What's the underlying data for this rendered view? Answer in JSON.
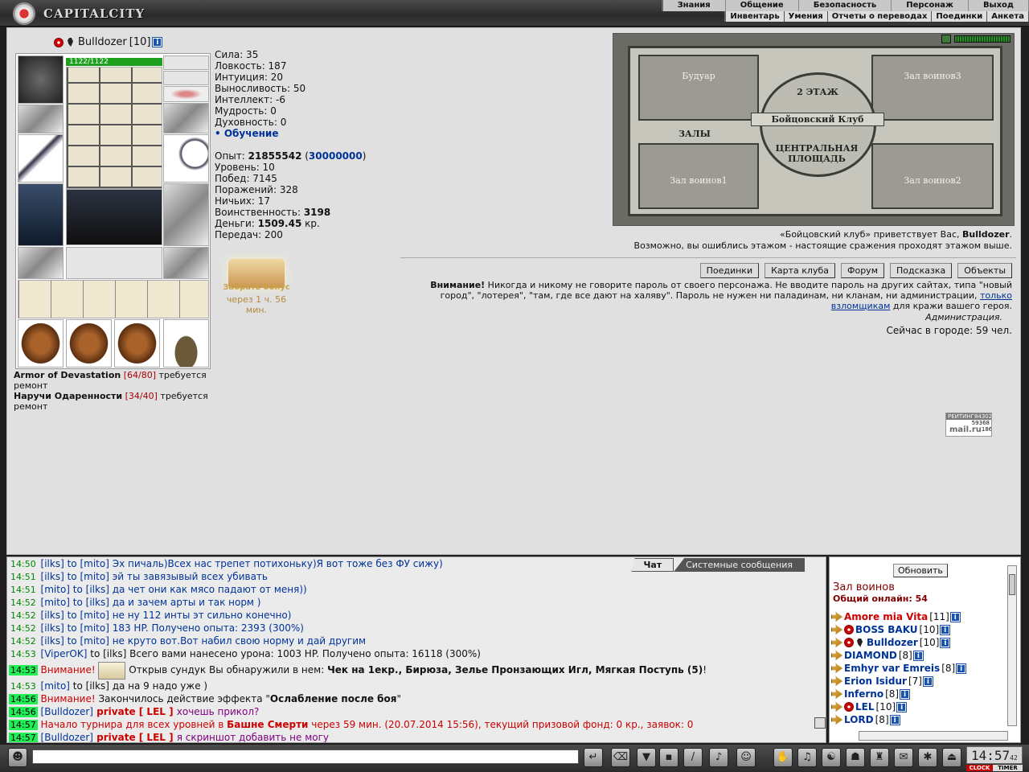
{
  "header": {
    "logo": "CAPITALCITY",
    "menu_top": [
      "Знания",
      "Общение",
      "Безопасность",
      "Персонаж",
      "Выход"
    ],
    "menu_sub": [
      "Инвентарь",
      "Умения",
      "Отчеты о переводах",
      "Поединки",
      "Анкета"
    ]
  },
  "character": {
    "name": "Bulldozer",
    "level": "[10]",
    "hp": "1122/1122"
  },
  "stats": {
    "lines": [
      "Сила: 35",
      "Ловкость: 187",
      "Интуиция: 20",
      "Выносливость: 50",
      "Интеллект: -6",
      "Мудрость: 0",
      "Духовность: 0"
    ],
    "training": "• Обучение",
    "exp_label": "Опыт: ",
    "exp": "21855542",
    "exp_next": "30000000",
    "level": "Уровень: 10",
    "wins": "Побед: 7145",
    "losses": "Поражений: 328",
    "draws": "Ничьих: 17",
    "valor_label": "Воинственность: ",
    "valor": "3198",
    "money_label": "Деньги: ",
    "money": "1509.45",
    "money_unit": " кр.",
    "transfers": "Передач: 200"
  },
  "bonus": {
    "label": "Забрать бонус",
    "time": "через 1 ч. 56 мин."
  },
  "repairs": [
    {
      "name": "Armor of Devastation",
      "dur": "[64/80]",
      "need": " требуется ремонт"
    },
    {
      "name": "Наручи Одаренности",
      "dur": "[34/40]",
      "need": " требуется ремонт"
    }
  ],
  "map": {
    "rooms": [
      "Будуар",
      "Зал воинов3",
      "Зал воинов1",
      "Зал воинов2"
    ],
    "floor": "2 ЭТАЖ",
    "club": "Бойцовский Клуб",
    "halls": "ЗАЛЫ",
    "square": "ЦЕНТРАЛЬНАЯ ПЛОЩАДЬ"
  },
  "welcome": {
    "line1_a": "«Бойцовский клуб» приветствует Вас, ",
    "line1_name": "Bulldozer",
    "line1_end": ".",
    "line2": "Возможно, вы ошиблись этажом - настоящие сражения проходят этажом выше."
  },
  "nav_buttons": [
    "Поединки",
    "Карта клуба",
    "Форум",
    "Подсказка",
    "Объекты"
  ],
  "warning": {
    "title": "Внимание!",
    "text": " Никогда и никому не говорите пароль от своего персонажа. Не вводите пароль на других сайтах, типа \"новый город\", \"лотерея\", \"там, где все дают на халяву\". Пароль не нужен ни паладинам, ни кланам, ни администрации, ",
    "link": "только взломщикам",
    "end": " для кражи вашего героя.",
    "sign": "Администрация.",
    "online": "Сейчас в городе: 59 чел."
  },
  "rating": {
    "label": "РЕЙТИНГ",
    "v1": "8430242",
    "v2": "59368",
    "v3": "186",
    "brand": "mail.ru"
  },
  "chat": {
    "tabs": [
      "Чат",
      "Системные сообщения"
    ],
    "lines": [
      {
        "t": "14:50",
        "from": "[ilks]",
        "to": " to [mito] ",
        "text": "Эх пичаль)Всех нас трепет потихоньку)Я вот тоже без ФУ сижу)"
      },
      {
        "t": "14:51",
        "from": "[ilks]",
        "to": " to [mito] ",
        "text": "эй ты завязывый всех убивать"
      },
      {
        "t": "14:51",
        "from": "[mito]",
        "to": " to [ilks] ",
        "text": "да чет они как мясо падают от меня))"
      },
      {
        "t": "14:52",
        "from": "[mito]",
        "to": " to [ilks] ",
        "text": "да и зачем арты и так норм )"
      },
      {
        "t": "14:52",
        "from": "[ilks]",
        "to": " to [mito] ",
        "text": "не ну 112 инты эт сильно конечно)"
      },
      {
        "t": "14:52",
        "from": "[ilks]",
        "to": " to [mito] ",
        "text": "183 HP. Получено опыта: 2393 (300%)"
      },
      {
        "t": "14:52",
        "from": "[ilks]",
        "to": " to [mito] ",
        "text": "не круто вот.Вот набил свою норму и дай другим"
      },
      {
        "t": "14:53",
        "from": "[ViperOK]",
        "to": " to [ilks] ",
        "text": "Всего вами нанесено урона: 1003 HP. Получено опыта: 16118 (300%)"
      }
    ],
    "sys1": {
      "t": "14:53",
      "warn": "Внимание!",
      "pre": " Открыв сундук Вы обнаружили в нем: ",
      "items": "Чек на 1екр., Бирюза, Зелье Пронзающих Игл, Мягкая Поступь (5)",
      "end": "!"
    },
    "line9": {
      "t": "14:53",
      "from": "[mito]",
      "to": " to [ilks] ",
      "text": "да на 9 надо уже )"
    },
    "sys2": {
      "t": "14:56",
      "warn": "Внимание!",
      "pre": " Закончилось действие эффекта \"",
      "effect": "Ослабление после боя",
      "end": "\""
    },
    "priv1": {
      "t": "14:56",
      "from": "[Bulldozer]",
      "p": " private [ LEL ] ",
      "text": "хочешь прикол?"
    },
    "tourn": {
      "t": "14:57",
      "pre": "Начало турнира для всех уровней в ",
      "place": "Башне Смерти",
      "text": " через 59 мин. (20.07.2014 15:56), текущий призовой фонд: 0 кр., заявок: 0"
    },
    "priv2": {
      "t": "14:57",
      "from": "[Bulldozer]",
      "p": " private [ LEL ] ",
      "text": "я скриншот добавить не могу"
    }
  },
  "online": {
    "refresh": "Обновить",
    "room": "Зал воинов",
    "count": "Общий онлайн: 54",
    "users": [
      {
        "n": "Amore mia Vita",
        "l": "[11]",
        "red": true
      },
      {
        "n": "BOSS BAKU",
        "l": "[10]",
        "red": false
      },
      {
        "n": "Bulldozer",
        "l": "[10]",
        "red": false
      },
      {
        "n": "DIAMOND",
        "l": "[8]",
        "red": false
      },
      {
        "n": "Emhyr var Emreis",
        "l": "[8]",
        "red": false
      },
      {
        "n": "Erion Isidur",
        "l": "[7]",
        "red": false
      },
      {
        "n": "Inferno",
        "l": "[8]",
        "red": false
      },
      {
        "n": "LEL",
        "l": "[10]",
        "red": false
      },
      {
        "n": "LORD",
        "l": "[8]",
        "red": false
      }
    ]
  },
  "clock": {
    "time": "14:57",
    "sec": "42",
    "l1": "CLOCK",
    "l2": "TIMER"
  }
}
